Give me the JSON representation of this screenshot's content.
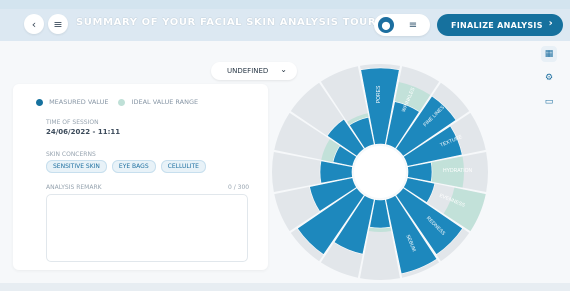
{
  "topbar": {
    "back_icon": "chevron-left-icon",
    "menu_icon": "hamburger-menu-icon",
    "title": "SUMMARY OF YOUR FACIAL SKIN ANALYSIS TOUR",
    "view_toggle": {
      "active_icon": "grid-icon",
      "inactive_icon": "list-icon"
    },
    "finalize_label": "FINALIZE ANALYSIS",
    "finalize_icon": "chevron-right-icon"
  },
  "right_toolbar": [
    "grid-view-icon",
    "settings-icon",
    "message-icon"
  ],
  "dropdown": {
    "value": "UNDEFINED",
    "icon": "chevron-down-icon"
  },
  "panel": {
    "legend": {
      "measured": "MEASURED VALUE",
      "ideal": "IDEAL VALUE RANGE"
    },
    "session": {
      "label": "TIME OF SESSION",
      "value": "24/06/2022 - 11:11"
    },
    "concerns": {
      "label": "SKIN CONCERNS",
      "tags": [
        "SENSITIVE SKIN",
        "EYE BAGS",
        "CELLULITE"
      ]
    },
    "remark": {
      "label": "ANALYSIS REMARK",
      "count": "0 / 300"
    }
  },
  "colors": {
    "accent": "#16719e",
    "measured": "#1d88bd",
    "ideal": "#bfe0d7",
    "track": "#e2e6ea",
    "topbar": "#dce8f2"
  },
  "chart_data": {
    "type": "radial-bar",
    "series": [
      {
        "name": "MEASURED VALUE",
        "values": [
          0.95,
          0.55,
          0.8,
          0.7,
          0.3,
          0.35,
          0.9,
          0.95,
          0.35,
          0.7,
          0.9,
          0.55,
          0.4,
          0.25,
          0.45,
          0.35
        ]
      },
      {
        "name": "IDEAL VALUE RANGE",
        "values": [
          0.2,
          0.6,
          0.2,
          0.2,
          0.5,
          0.8,
          0.3,
          0.6,
          0.2,
          0.3,
          0.5,
          0.2,
          0.2,
          0.2,
          0.2,
          0.2
        ]
      }
    ],
    "labels": [
      "PORES",
      "WRINKLES",
      "FINE LINES",
      "TEXTURE",
      "HYDRATION",
      "EVENNESS",
      "REDNESS",
      "SEBUM",
      "",
      "",
      "",
      "",
      "",
      "",
      "",
      ""
    ]
  }
}
